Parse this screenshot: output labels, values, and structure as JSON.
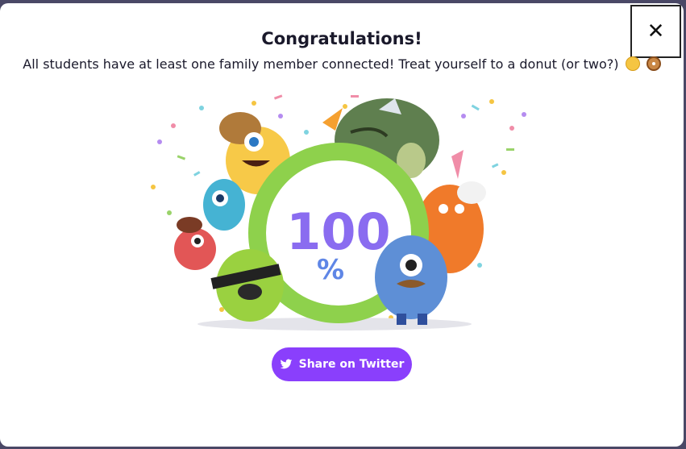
{
  "dialog": {
    "title": "Congratulations!",
    "message": "All students have at least one family member connected! Treat yourself to a donut (or two?)",
    "close_label": "✕"
  },
  "illustration": {
    "percent_number": "100",
    "percent_sign": "%"
  },
  "share": {
    "label": "Share on Twitter"
  },
  "colors": {
    "accent": "#8a3ffc",
    "ring": "#8ed14c"
  }
}
